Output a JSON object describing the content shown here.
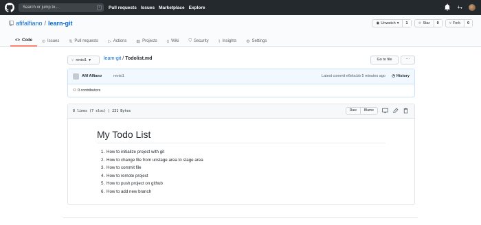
{
  "header": {
    "search_placeholder": "Search or jump to...",
    "search_key": "/",
    "nav": [
      "Pull requests",
      "Issues",
      "Marketplace",
      "Explore"
    ],
    "icons": [
      "bell-icon",
      "plus-icon",
      "avatar"
    ]
  },
  "repo": {
    "owner": "afifalfiano",
    "separator": "/",
    "name": "learn-git",
    "watch": {
      "label": "Unwatch",
      "count": "1"
    },
    "star": {
      "label": "Star",
      "count": "0"
    },
    "fork": {
      "label": "Fork",
      "count": "0"
    }
  },
  "tabs": [
    {
      "label": "Code",
      "icon": "code-icon",
      "active": true
    },
    {
      "label": "Issues",
      "icon": "issue-icon"
    },
    {
      "label": "Pull requests",
      "icon": "pull-request-icon"
    },
    {
      "label": "Actions",
      "icon": "play-icon"
    },
    {
      "label": "Projects",
      "icon": "project-icon"
    },
    {
      "label": "Wiki",
      "icon": "book-icon"
    },
    {
      "label": "Security",
      "icon": "shield-icon"
    },
    {
      "label": "Insights",
      "icon": "graph-icon"
    },
    {
      "label": "Settings",
      "icon": "gear-icon"
    }
  ],
  "branch": "revisi1",
  "breadcrumb": {
    "repo": "learn-git",
    "sep": "/",
    "file": "Todolist.md"
  },
  "buttons": {
    "goto": "Go to file",
    "more": "···"
  },
  "commit": {
    "author": "Afif Alfiano",
    "message": "revisi1",
    "latest": "Latest commit e6ebcbb 5 minutes ago",
    "history": "History"
  },
  "contributors": "0 contributors",
  "file": {
    "info": "8 lines (7 sloc)  |  231 Bytes",
    "raw": "Raw",
    "blame": "Blame"
  },
  "markdown": {
    "title": "My Todo List",
    "items": [
      {
        "num": "1.",
        "text": "How to initialize project with git"
      },
      {
        "num": "2.",
        "text": "How to change file from unstage area to stage area"
      },
      {
        "num": "3.",
        "text": "How to commit file"
      },
      {
        "num": "4.",
        "text": "How to remote project"
      },
      {
        "num": "5.",
        "text": "How to push project on github"
      },
      {
        "num": "6.",
        "text": "How to add new branch"
      }
    ]
  },
  "colors": {
    "header_bg": "#24292e",
    "link": "#0366d6",
    "active_tab": "#f9826c"
  }
}
